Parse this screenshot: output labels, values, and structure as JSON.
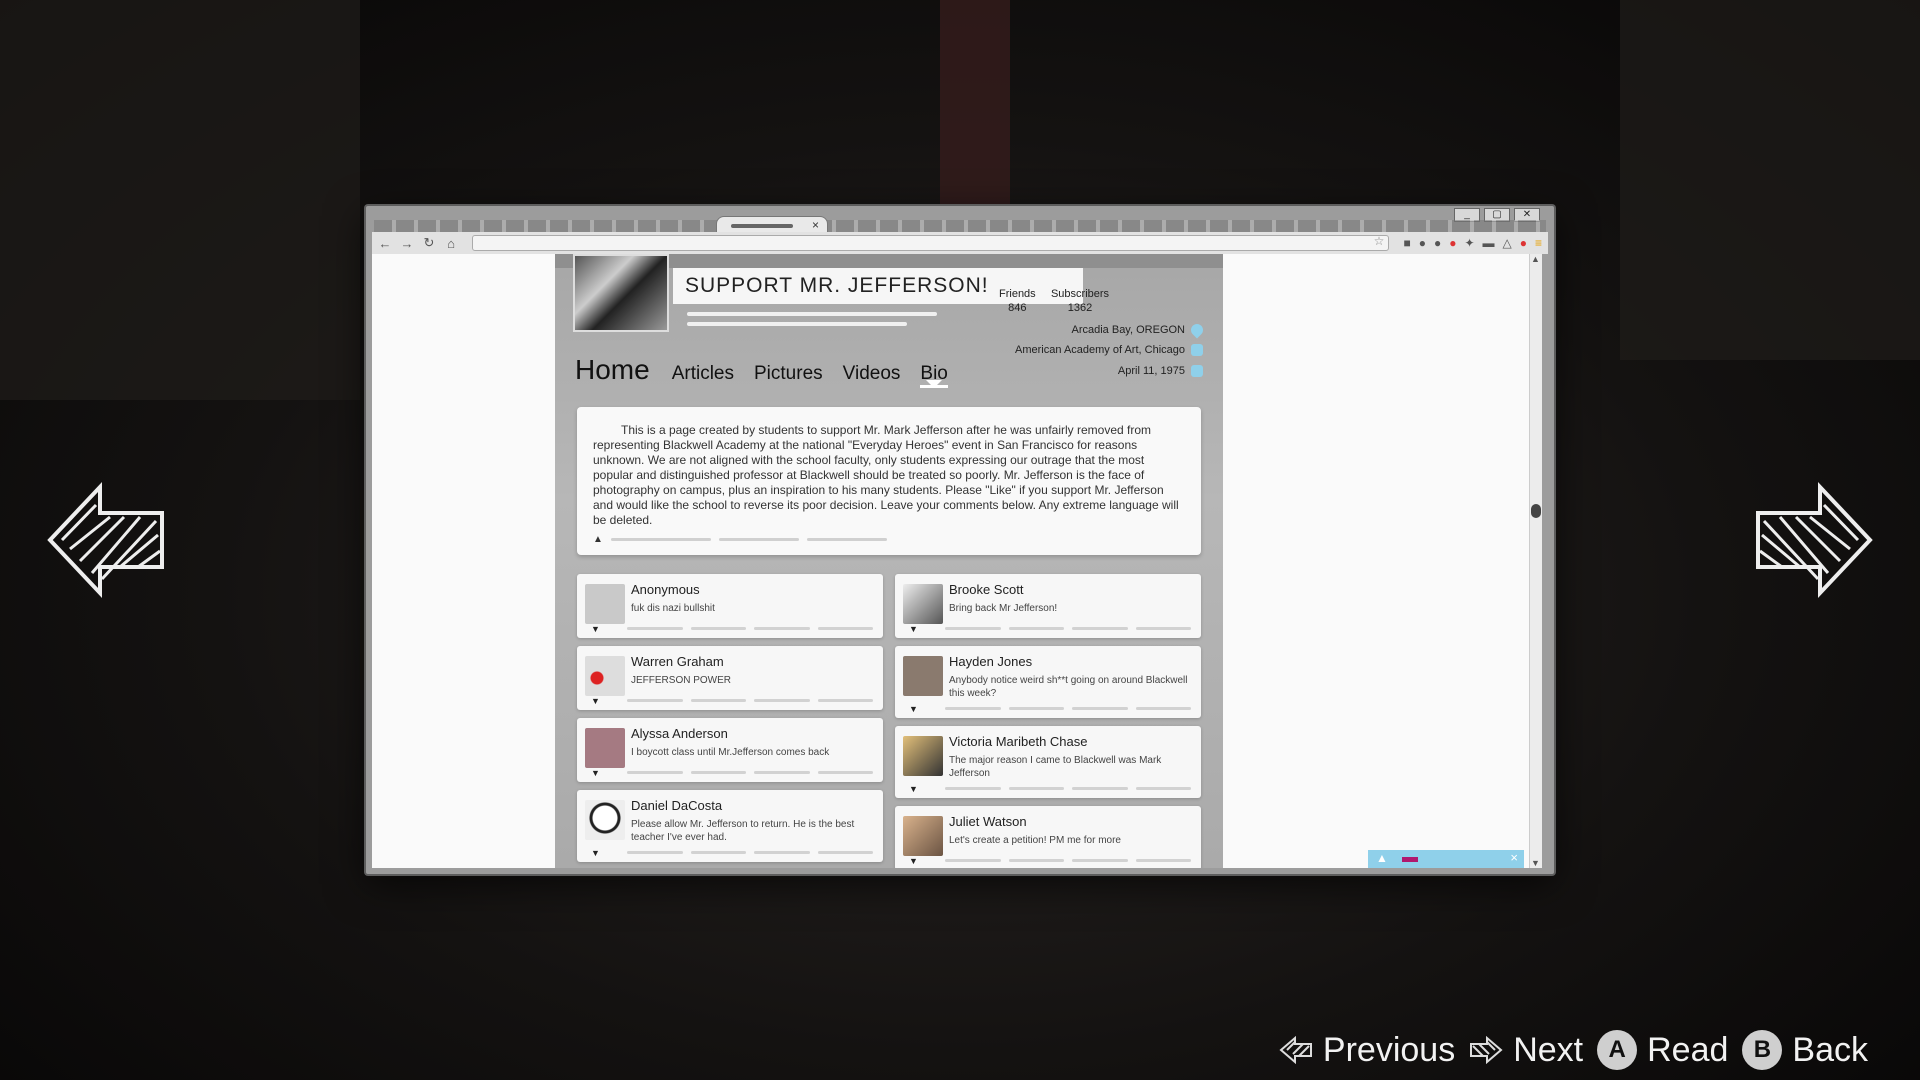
{
  "window": {
    "minimize": "_",
    "maximize": "▢",
    "close": "✕"
  },
  "page": {
    "title": "SUPPORT MR. JEFFERSON!",
    "stats": [
      {
        "label": "Friends",
        "value": "846"
      },
      {
        "label": "Subscribers",
        "value": "1362"
      }
    ],
    "info": {
      "location": "Arcadia Bay, OREGON",
      "school": "American Academy of Art, Chicago",
      "birthday": "April 11, 1975"
    },
    "nav": [
      "Home",
      "Articles",
      "Pictures",
      "Videos",
      "Bio"
    ],
    "active_nav": "Bio",
    "bio": "This is a page created by students to support Mr. Mark Jefferson after he was unfairly removed from representing Blackwell Academy at the national \"Everyday Heroes\" event in San Francisco for reasons unknown. We are not aligned with the school faculty, only students expressing our outrage that the most popular and distinguished professor at Blackwell should be treated so poorly. Mr. Jefferson is the face of photography on campus, plus an inspiration to his many students. Please \"Like\" if you support Mr. Jefferson and would like the school to reverse its poor decision. Leave your comments below. Any extreme language will be deleted."
  },
  "comments_left": [
    {
      "name": "Anonymous",
      "message": "fuk dis nazi bullshit"
    },
    {
      "name": "Warren Graham",
      "message": "JEFFERSON POWER"
    },
    {
      "name": "Alyssa Anderson",
      "message": "I boycott class until Mr.Jefferson comes back"
    },
    {
      "name": "Daniel DaCosta",
      "message": "Please allow Mr. Jefferson to return. He is the best teacher I've ever had."
    }
  ],
  "comments_right": [
    {
      "name": "Brooke Scott",
      "message": "Bring back Mr Jefferson!"
    },
    {
      "name": "Hayden Jones",
      "message": "Anybody notice weird sh**t going on around Blackwell this week?"
    },
    {
      "name": "Victoria Maribeth Chase",
      "message": "The major reason I came to Blackwell was Mark Jefferson"
    },
    {
      "name": "Juliet Watson",
      "message": "Let's create a petition! PM me for more"
    }
  ],
  "prompts": {
    "previous": "Previous",
    "next": "Next",
    "read_key": "A",
    "read": "Read",
    "back_key": "B",
    "back": "Back"
  },
  "colors": {
    "accent": "#8fd0ea",
    "chat_bar": "#b0186e"
  },
  "icons": [
    "arrow-left-icon",
    "arrow-right-icon",
    "location-pin-icon",
    "school-icon",
    "calendar-icon"
  ]
}
